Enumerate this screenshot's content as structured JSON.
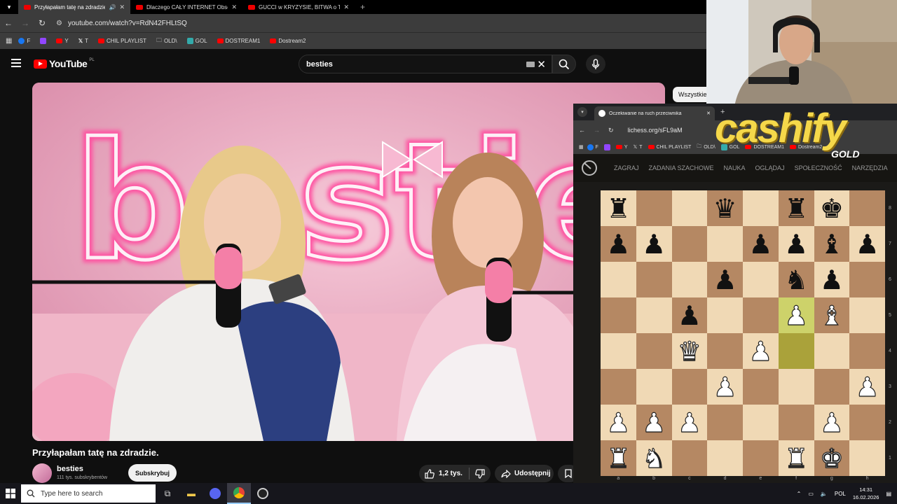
{
  "browser": {
    "tabs": [
      {
        "title": "Przyłapałam tatę na zdradzie",
        "active": true,
        "audio": true
      },
      {
        "title": "Dlaczego CAŁY INTERNET Obsesyjnie",
        "active": false
      },
      {
        "title": "GUCCI w KRYZYSIE, BITWA o TAJNE",
        "active": false
      }
    ],
    "url": "youtube.com/watch?v=RdN42FHLtSQ",
    "bookmarks": [
      "F",
      "Y",
      "T",
      "CHIL PLAYLIST",
      "OLD\\",
      "GOL",
      "DOSTREAM1",
      "Dostream2"
    ]
  },
  "youtube": {
    "logo_text": "YouTube",
    "country_code": "PL",
    "search_value": "besties",
    "video_title": "Przyłapałam tatę na zdradzie.",
    "channel_name": "besties",
    "subscribers": "111 tys. subskrybentów",
    "subscribe_label": "Subskrybuj",
    "likes": "1,2 tys.",
    "share_label": "Udostępnij",
    "chip_label": "Wszystkie",
    "neon_text": "besties"
  },
  "lichess": {
    "tab_title": "Oczekiwanie na ruch przeciwnika",
    "url": "lichess.org/sFL9aM",
    "bookmarks": [
      "F",
      "Y",
      "T",
      "CHIL PLAYLIST",
      "OLD\\",
      "GOL",
      "DOSTREAM1",
      "Dostream2"
    ],
    "nav": [
      "ZAGRAJ",
      "ZADANIA SZACHOWE",
      "NAUKA",
      "OGLĄDAJ",
      "SPOŁECZNOŚĆ",
      "NARZĘDZIA"
    ],
    "files": [
      "a",
      "b",
      "c",
      "d",
      "e",
      "f",
      "g",
      "h"
    ],
    "ranks": [
      "8",
      "7",
      "6",
      "5",
      "4",
      "3",
      "2",
      "1"
    ],
    "board": [
      [
        "bR",
        "",
        "",
        "bQ",
        "",
        "bR",
        "bK",
        ""
      ],
      [
        "bP",
        "bP",
        "",
        "",
        "bP",
        "bP",
        "bB",
        "bP"
      ],
      [
        "",
        "",
        "",
        "bP",
        "",
        "bN",
        "bP",
        ""
      ],
      [
        "",
        "",
        "bP",
        "",
        "",
        "wP",
        "wB",
        ""
      ],
      [
        "",
        "",
        "wQ",
        "",
        "wP",
        "",
        "",
        ""
      ],
      [
        "",
        "",
        "",
        "wP",
        "",
        "",
        "",
        "wP"
      ],
      [
        "wP",
        "wP",
        "wP",
        "",
        "",
        "",
        "wP",
        ""
      ],
      [
        "wR",
        "wN",
        "",
        "",
        "",
        "wR",
        "wK",
        ""
      ]
    ],
    "last_move": [
      "f5",
      "f4"
    ]
  },
  "overlay": {
    "brand": "cashify",
    "brand_sub": "GOLD"
  },
  "taskbar": {
    "search_placeholder": "Type here to search",
    "language": "POL",
    "time": "14:31",
    "date": "16.02.2026"
  }
}
